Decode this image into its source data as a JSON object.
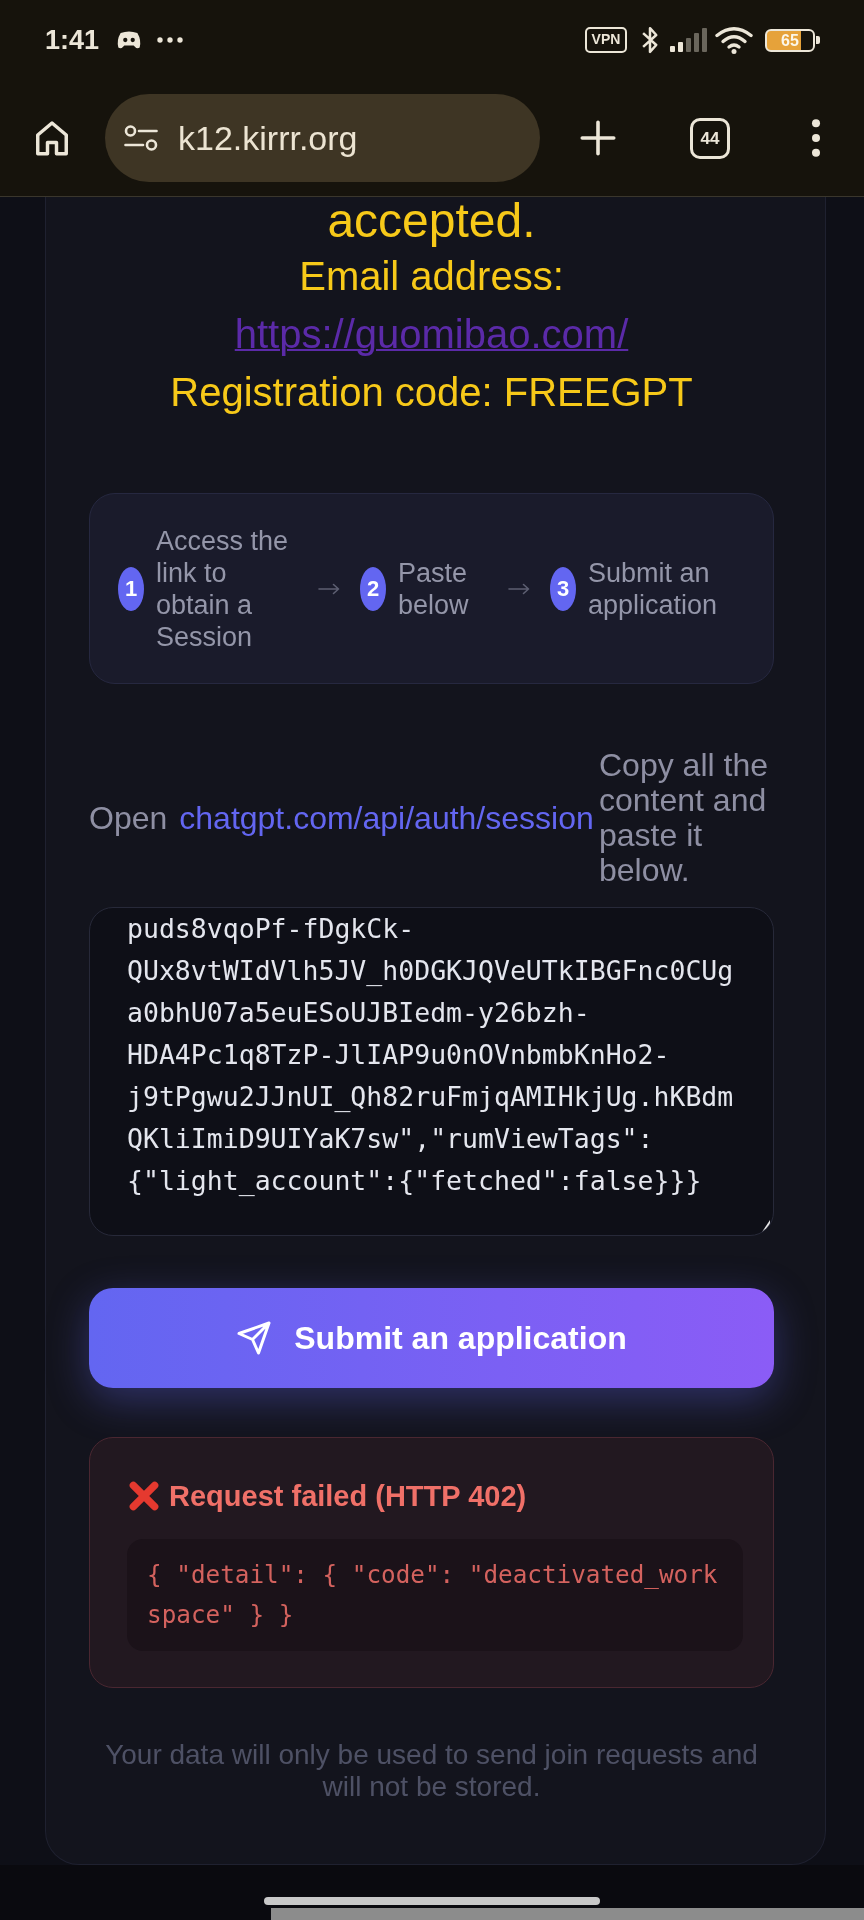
{
  "status_bar": {
    "time": "1:41",
    "vpn_label": "VPN",
    "battery": "65"
  },
  "browser_toolbar": {
    "url": "k12.kirrr.org",
    "tab_count": "44"
  },
  "notice": {
    "heading": "accepted.",
    "email_label": "Email address:",
    "email_link": "https://guomibao.com/",
    "code_line": "Registration code: FREEGPT"
  },
  "steps": [
    {
      "number": "1",
      "label": "Access the link to obtain a Session"
    },
    {
      "number": "2",
      "label": "Paste below"
    },
    {
      "number": "3",
      "label": "Submit an application"
    }
  ],
  "session_hint": {
    "prefix": "Open",
    "link": "chatgpt.com/api/auth/session",
    "suffix": "Copy all the content and paste it below."
  },
  "session_field": {
    "value": "puds8vqoPf-fDgkCk-QUx8vtWIdVlh5JV_h0DGKJQVeUTkIBGFnc0CUga0bhU07a5euESoUJBIedm-y26bzh-HDA4Pc1q8TzP-JlIAP9u0nOVnbmbKnHo2-j9tPgwu2JJnUI_Qh82ruFmjqAMIHkjUg.hKBdmQKliImiD9UIYaK7sw\",\"rumViewTags\":{\"light_account\":{\"fetched\":false}}}"
  },
  "submit_button": {
    "label": "Submit an application"
  },
  "error": {
    "title": "Request failed (HTTP 402)",
    "detail": "{ \"detail\": { \"code\": \"deactivated_workspace\" } }"
  },
  "footer_note": "Your data will only be used to send join requests and will not be stored."
}
